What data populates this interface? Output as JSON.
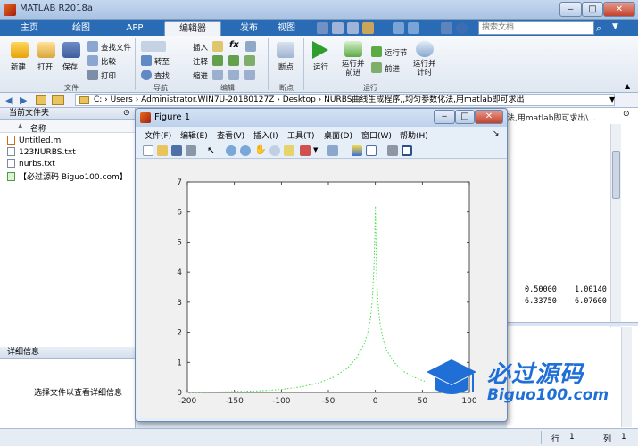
{
  "window": {
    "title": "MATLAB R2018a"
  },
  "tabs": [
    "主页",
    "绘图",
    "APP",
    "编辑器",
    "发布",
    "视图"
  ],
  "active_tab": "编辑器",
  "search": {
    "placeholder": "搜索文档"
  },
  "ribbon": {
    "file": {
      "new": "新建",
      "open": "打开",
      "save": "保存",
      "find_files": "查找文件",
      "compare": "比较",
      "print": "打印",
      "group": "文件"
    },
    "nav": {
      "goto": "转至",
      "find": "查找",
      "group": "导航"
    },
    "edit": {
      "insert": "插入",
      "comment": "注释",
      "indent": "缩进",
      "fx": "fx",
      "group": "编辑"
    },
    "breakpoints": {
      "label": "断点",
      "group": "断点"
    },
    "run": {
      "run": "运行",
      "run_advance": "运行并\n前进",
      "run_section": "运行节",
      "advance": "前进",
      "run_time": "运行并\n计时",
      "group": "运行"
    }
  },
  "address": {
    "path": "C: › Users › Administrator.WIN7U-20180127Z › Desktop › NURBS曲线生成程序,,均匀参数化法,用matlab即可求出"
  },
  "left_panel": {
    "header": "当前文件夹",
    "col_name": "名称",
    "files": [
      "Untitled.m",
      "123NURBS.txt",
      "nurbs.txt",
      "【必过源码 Biguo100.com】"
    ],
    "detail_header": "详细信息",
    "detail_msg": "选择文件以查看详细信息"
  },
  "right_panel": {
    "path_tail": "法,用matlab即可求出\\...",
    "values": [
      [
        "0.50000",
        "1.00140"
      ],
      [
        "6.33750",
        "6.07600"
      ]
    ]
  },
  "figure": {
    "title": "Figure 1",
    "menu": [
      "文件(F)",
      "编辑(E)",
      "查看(V)",
      "插入(I)",
      "工具(T)",
      "桌面(D)",
      "窗口(W)",
      "帮助(H)"
    ]
  },
  "status": {
    "row_label": "行",
    "row": "1",
    "col_label": "列",
    "col": "1"
  },
  "watermark": {
    "text1": "必过源码",
    "text2": "Biguo100.com"
  },
  "chart_data": {
    "type": "scatter",
    "x_ticks": [
      -200,
      -150,
      -100,
      -50,
      0,
      50,
      100
    ],
    "y_ticks": [
      0,
      1,
      2,
      3,
      4,
      5,
      6,
      7
    ],
    "xlim": [
      -200,
      100
    ],
    "ylim": [
      0,
      7
    ],
    "series": [
      {
        "color": "#44dd44",
        "style": "dotted",
        "points": [
          [
            -200,
            0.0
          ],
          [
            -180,
            0.01
          ],
          [
            -160,
            0.02
          ],
          [
            -140,
            0.04
          ],
          [
            -120,
            0.06
          ],
          [
            -100,
            0.1
          ],
          [
            -80,
            0.18
          ],
          [
            -60,
            0.32
          ],
          [
            -45,
            0.5
          ],
          [
            -30,
            0.8
          ],
          [
            -20,
            1.15
          ],
          [
            -12,
            1.6
          ],
          [
            -8,
            2.0
          ],
          [
            -5,
            2.5
          ],
          [
            -3,
            3.2
          ],
          [
            -1.5,
            4.2
          ],
          [
            -0.6,
            5.2
          ],
          [
            0,
            6.2
          ],
          [
            0.6,
            5.0
          ],
          [
            1.5,
            3.8
          ],
          [
            3,
            2.9
          ],
          [
            5,
            2.3
          ],
          [
            8,
            1.8
          ],
          [
            12,
            1.4
          ],
          [
            20,
            1.0
          ],
          [
            30,
            0.7
          ],
          [
            45,
            0.45
          ],
          [
            55,
            0.35
          ]
        ]
      }
    ]
  }
}
